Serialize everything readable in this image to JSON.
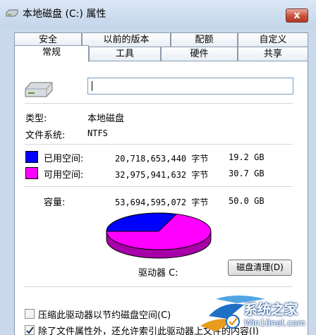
{
  "window": {
    "title": "本地磁盘 (C:) 属性",
    "close_glyph": "x"
  },
  "tabs_row1": [
    "安全",
    "以前的版本",
    "配额",
    "自定义"
  ],
  "tabs_row2": [
    "常规",
    "工具",
    "硬件",
    "共享"
  ],
  "general": {
    "volume_label_value": "",
    "type_label": "类型:",
    "type_value": "本地磁盘",
    "fs_label": "文件系统:",
    "fs_value": "NTFS",
    "used": {
      "label": "已用空间:",
      "bytes": "20,718,653,440 字节",
      "size": "19.2 GB",
      "color": "#0000ff"
    },
    "free": {
      "label": "可用空间:",
      "bytes": "32,975,941,632 字节",
      "size": "30.7 GB",
      "color": "#ff00ff"
    },
    "capacity": {
      "label": "容量:",
      "bytes": "53,694,595,072 字节",
      "size": "50.0 GB"
    },
    "drive_label": "驱动器 C:",
    "cleanup_button": "磁盘清理(D)",
    "compress_checkbox": "压缩此驱动器以节约磁盘空间(C)",
    "index_checkbox": "除了文件属性外，还允许索引此驱动器上文件的内容(I)"
  },
  "watermark": {
    "brand": "系统之家",
    "url": "Win10net.com"
  }
}
